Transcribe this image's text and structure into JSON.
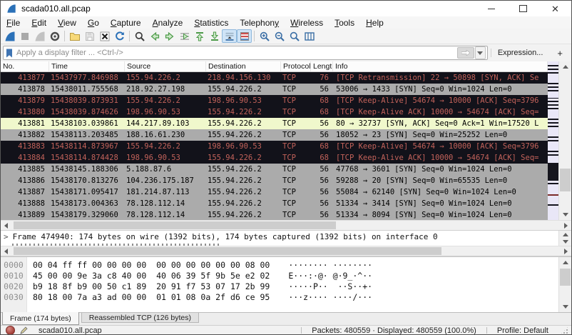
{
  "window": {
    "title": "scada010.all.pcap",
    "controls": [
      "minimize",
      "maximize",
      "close"
    ]
  },
  "menu": {
    "items": [
      {
        "label": "File",
        "accel": "F"
      },
      {
        "label": "Edit",
        "accel": "E"
      },
      {
        "label": "View",
        "accel": "V"
      },
      {
        "label": "Go",
        "accel": "G"
      },
      {
        "label": "Capture",
        "accel": "C"
      },
      {
        "label": "Analyze",
        "accel": "A"
      },
      {
        "label": "Statistics",
        "accel": "S"
      },
      {
        "label": "Telephony",
        "accel": "y"
      },
      {
        "label": "Wireless",
        "accel": "W"
      },
      {
        "label": "Tools",
        "accel": "T"
      },
      {
        "label": "Help",
        "accel": "H"
      }
    ]
  },
  "toolbar": {
    "items": [
      {
        "icon": "fin",
        "name": "start-capture",
        "enabled": true
      },
      {
        "icon": "stop",
        "name": "stop-capture",
        "enabled": false
      },
      {
        "icon": "fin_gray",
        "name": "restart-capture",
        "enabled": false
      },
      {
        "icon": "gear",
        "name": "capture-options",
        "enabled": true
      },
      {
        "icon": "sep"
      },
      {
        "icon": "folder",
        "name": "open-file",
        "enabled": true
      },
      {
        "icon": "save",
        "name": "save-file",
        "enabled": false
      },
      {
        "icon": "closefile",
        "name": "close-file",
        "enabled": true
      },
      {
        "icon": "reload",
        "name": "reload-file",
        "enabled": true
      },
      {
        "icon": "sep"
      },
      {
        "icon": "find",
        "name": "find-packet",
        "enabled": true
      },
      {
        "icon": "arrow_left",
        "name": "go-back",
        "enabled": true
      },
      {
        "icon": "arrow_right",
        "name": "go-forward",
        "enabled": true
      },
      {
        "icon": "goto",
        "name": "go-to-packet",
        "enabled": true
      },
      {
        "icon": "to_top",
        "name": "go-first-packet",
        "enabled": true
      },
      {
        "icon": "to_bottom",
        "name": "go-last-packet",
        "enabled": true
      },
      {
        "icon": "autoscroll",
        "name": "auto-scroll-toggle",
        "enabled": true,
        "pressed": true
      },
      {
        "icon": "colorize",
        "name": "colorize-toggle",
        "enabled": true,
        "pressed": true
      },
      {
        "icon": "sep"
      },
      {
        "icon": "zoom_in",
        "name": "zoom-in",
        "enabled": true
      },
      {
        "icon": "zoom_out",
        "name": "zoom-out",
        "enabled": true
      },
      {
        "icon": "zoom_orig",
        "name": "zoom-100",
        "enabled": true
      },
      {
        "icon": "resize_cols",
        "name": "resize-columns",
        "enabled": true
      }
    ]
  },
  "filter": {
    "placeholder": "Apply a display filter ... <Ctrl-/>",
    "expression_label": "Expression...",
    "add_label": "+"
  },
  "packet_list": {
    "columns": [
      "No.",
      "Time",
      "Source",
      "Destination",
      "Protocol",
      "Lengt",
      "Info"
    ],
    "rows": [
      {
        "no": "413877",
        "time": "15437977.846988",
        "src": "155.94.226.2",
        "dst": "218.94.156.130",
        "proto": "TCP",
        "len": "76",
        "info": "[TCP Retransmission] 22 → 50898 [SYN, ACK] Se",
        "style": "bad"
      },
      {
        "no": "413878",
        "time": "15438011.755568",
        "src": "218.92.27.198",
        "dst": "155.94.226.2",
        "proto": "TCP",
        "len": "56",
        "info": "53006 → 1433 [SYN] Seq=0 Win=1024 Len=0",
        "style": "gray"
      },
      {
        "no": "413879",
        "time": "15438039.873931",
        "src": "155.94.226.2",
        "dst": "198.96.90.53",
        "proto": "TCP",
        "len": "68",
        "info": "[TCP Keep-Alive] 54674 → 10000 [ACK] Seq=3796",
        "style": "bad"
      },
      {
        "no": "413880",
        "time": "15438039.874626",
        "src": "198.96.90.53",
        "dst": "155.94.226.2",
        "proto": "TCP",
        "len": "68",
        "info": "[TCP Keep-Alive ACK] 10000 → 54674 [ACK] Seq=",
        "style": "bad"
      },
      {
        "no": "413881",
        "time": "15438103.039861",
        "src": "144.217.89.103",
        "dst": "155.94.226.2",
        "proto": "TCP",
        "len": "56",
        "info": "80 → 32737 [SYN, ACK] Seq=0 Ack=1 Win=17520 L",
        "style": "sel"
      },
      {
        "no": "413882",
        "time": "15438113.203485",
        "src": "188.16.61.230",
        "dst": "155.94.226.2",
        "proto": "TCP",
        "len": "56",
        "info": "18052 → 23 [SYN] Seq=0 Win=25252 Len=0",
        "style": "gray"
      },
      {
        "no": "413883",
        "time": "15438114.873967",
        "src": "155.94.226.2",
        "dst": "198.96.90.53",
        "proto": "TCP",
        "len": "68",
        "info": "[TCP Keep-Alive] 54674 → 10000 [ACK] Seq=3796",
        "style": "bad"
      },
      {
        "no": "413884",
        "time": "15438114.874428",
        "src": "198.96.90.53",
        "dst": "155.94.226.2",
        "proto": "TCP",
        "len": "68",
        "info": "[TCP Keep-Alive ACK] 10000 → 54674 [ACK] Seq=",
        "style": "bad"
      },
      {
        "no": "413885",
        "time": "15438145.188306",
        "src": "5.188.87.6",
        "dst": "155.94.226.2",
        "proto": "TCP",
        "len": "56",
        "info": "47768 → 3601 [SYN] Seq=0 Win=1024 Len=0",
        "style": "gray"
      },
      {
        "no": "413886",
        "time": "15438170.813276",
        "src": "104.236.175.187",
        "dst": "155.94.226.2",
        "proto": "TCP",
        "len": "56",
        "info": "59288 → 20 [SYN] Seq=0 Win=65535 Len=0",
        "style": "gray"
      },
      {
        "no": "413887",
        "time": "15438171.095417",
        "src": "181.214.87.113",
        "dst": "155.94.226.2",
        "proto": "TCP",
        "len": "56",
        "info": "55084 → 62140 [SYN] Seq=0 Win=1024 Len=0",
        "style": "gray"
      },
      {
        "no": "413888",
        "time": "15438173.004363",
        "src": "78.128.112.14",
        "dst": "155.94.226.2",
        "proto": "TCP",
        "len": "56",
        "info": "51334 → 3414 [SYN] Seq=0 Win=1024 Len=0",
        "style": "gray"
      },
      {
        "no": "413889",
        "time": "15438179.329060",
        "src": "78.128.112.14",
        "dst": "155.94.226.2",
        "proto": "TCP",
        "len": "56",
        "info": "51334 → 8094 [SYN] Seq=0 Win=1024 Len=0",
        "style": "gray"
      }
    ]
  },
  "details": {
    "expander": ">",
    "line": "Frame 474940: 174 bytes on wire (1392 bits), 174 bytes captured (1392 bits) on interface 0"
  },
  "hex_dump": {
    "rows": [
      {
        "offset": "0000",
        "hex": "00 04 ff ff 00 00 00 00  00 00 00 00 00 00 08 00",
        "ascii": "········ ········"
      },
      {
        "offset": "0010",
        "hex": "45 00 00 9e 3a c8 40 00  40 06 39 5f 9b 5e e2 02",
        "ascii": "E···:·@· @·9_·^··"
      },
      {
        "offset": "0020",
        "hex": "b9 18 8f b9 00 50 c1 89  20 91 f7 53 07 17 2b 99",
        "ascii": "·····P··  ··S··+·"
      },
      {
        "offset": "0030",
        "hex": "80 18 00 7a a3 ad 00 00  01 01 08 0a 2f d6 ce 95",
        "ascii": "···z···· ····/···"
      }
    ]
  },
  "byte_tabs": [
    {
      "label": "Frame (174 bytes)",
      "active": true
    },
    {
      "label": "Reassembled TCP (126 bytes)",
      "active": false
    }
  ],
  "status": {
    "filename": "scada010.all.pcap",
    "packets": "Packets: 480559 · Displayed: 480559 (100.0%)",
    "profile": "Profile: Default"
  },
  "colors": {
    "bad_tcp_bg": "#12121a",
    "bad_tcp_fg": "#c2625a",
    "row_gray_bg": "#ababab",
    "selected_row_bg": "#f0f8cc",
    "minimap_bg": "#e9e7f7",
    "accent_blue": "#2b71b8"
  }
}
